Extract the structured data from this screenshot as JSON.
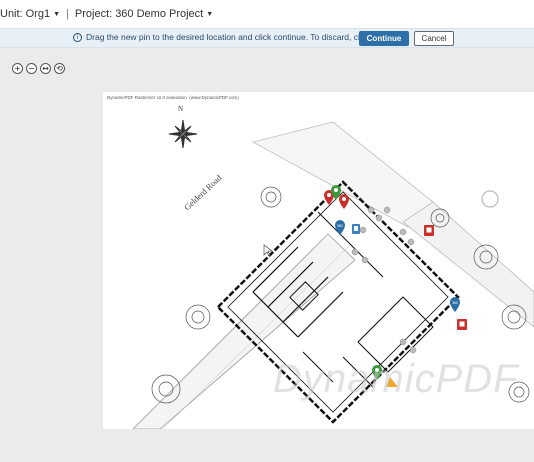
{
  "header": {
    "unit_label": "Unit:",
    "unit_value": "Org1",
    "separator": "|",
    "project_label": "Project:",
    "project_value": "360 Demo Project"
  },
  "banner": {
    "message": "Drag the new pin to the desired location and click continue. To discard, click cancel.",
    "continue_label": "Continue",
    "cancel_label": "Cancel"
  },
  "zoom_controls": {
    "zoom_in": "+",
    "zoom_out": "−",
    "fit": "↔",
    "reset": "⟲"
  },
  "plan": {
    "evaluation_note": "DynamicPDF Rasterizer v2.0 evaluation. (www.DynamicPDF.com)",
    "road_name": "Gelderd Road",
    "north_marker": "N",
    "watermark": "DynamicPDF"
  },
  "colors": {
    "primary": "#2d6fa8",
    "pin_red": "#c9302c",
    "pin_green": "#3a9a3a",
    "pin_blue": "#3a7fc4",
    "banner_bg": "#e8f0f7"
  }
}
